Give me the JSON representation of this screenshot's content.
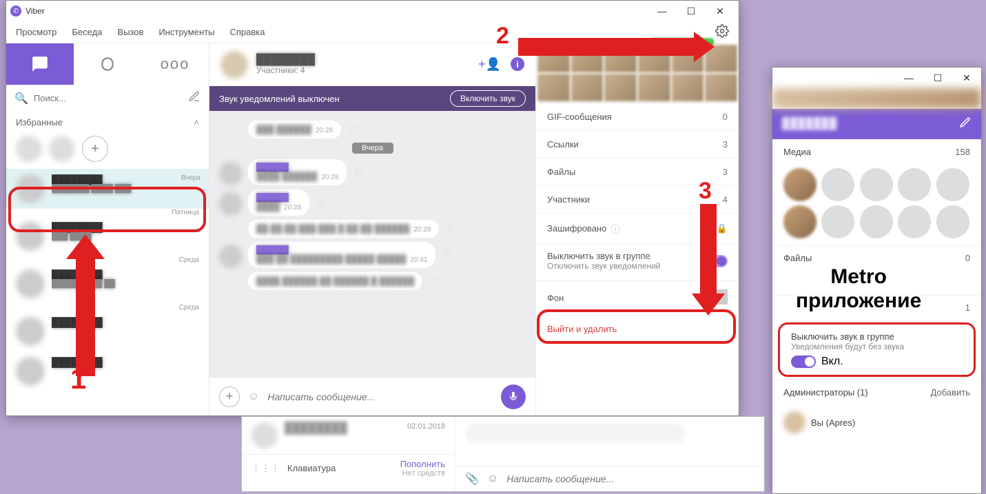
{
  "window": {
    "title": "Viber"
  },
  "menubar": [
    "Просмотр",
    "Беседа",
    "Вызов",
    "Инструменты",
    "Справка"
  ],
  "sidebar": {
    "search_placeholder": "Поиск...",
    "favorites_label": "Избранные",
    "chats": [
      {
        "time": "Вчера"
      },
      {
        "time": "Пятница"
      },
      {
        "time": "Среда"
      },
      {
        "time": "Среда"
      },
      {
        "time": ""
      }
    ]
  },
  "chat": {
    "subtitle": "Участники: 4",
    "notif_banner": "Звук уведомлений выключен",
    "notif_button": "Включить звук",
    "date_pill": "Вчера",
    "msgs": [
      {
        "ts": "20:28"
      },
      {
        "ts": "20:28"
      },
      {
        "ts": "20:28"
      },
      {
        "ts": "20:29"
      },
      {
        "ts": "20:41"
      },
      {
        "ts": ""
      }
    ],
    "composer_placeholder": "Написать сообщение..."
  },
  "rightpanel": {
    "rows": {
      "gif": {
        "label": "GIF-сообщения",
        "value": "0"
      },
      "links": {
        "label": "Ссылки",
        "value": "3"
      },
      "files": {
        "label": "Файлы",
        "value": "3"
      },
      "members": {
        "label": "Участники",
        "value": "4"
      },
      "encrypted": {
        "label": "Зашифровано"
      },
      "mute_t1": "Выключить звук в группе",
      "mute_t2": "Отключить звук уведомлений",
      "bg": {
        "label": "Фон"
      },
      "leave": "Выйти и удалить"
    }
  },
  "bg_strip": {
    "date": "02.01.2018",
    "keyboard": "Клавиатура",
    "topup": "Пополнить",
    "no_funds": "Нет средств",
    "composer_placeholder": "Написать сообщение..."
  },
  "metro": {
    "media": {
      "label": "Медиа",
      "value": "158"
    },
    "files": {
      "label": "Файлы",
      "value": "0"
    },
    "members": {
      "value": "1"
    },
    "mute_t1": "Выключить звук в группе",
    "mute_t2": "Уведомления будут без звука",
    "mute_state": "Вкл.",
    "admins_label": "Администраторы (1)",
    "add": "Добавить",
    "admin_name": "Вы (Apres)"
  },
  "annotations": {
    "one": "1",
    "two": "2",
    "three": "3",
    "metro_label": "Metro\nприложение"
  }
}
